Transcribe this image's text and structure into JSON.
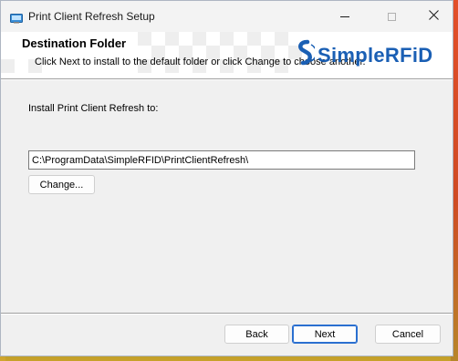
{
  "window": {
    "title": "Print Client Refresh Setup"
  },
  "banner": {
    "title": "Destination Folder",
    "description": "Click Next to install to the default folder or click Change to choose another.",
    "logo_text": "SimpleRFiD"
  },
  "main": {
    "install_label": "Install Print Client Refresh to:",
    "install_path": "C:\\ProgramData\\SimpleRFID\\PrintClientRefresh\\",
    "change_button": "Change..."
  },
  "footer": {
    "back_button": "Back",
    "next_button": "Next",
    "cancel_button": "Cancel"
  },
  "colors": {
    "logo_blue": "#1a5fb4",
    "default_button_border": "#2a6fd0"
  },
  "icons": [
    "installer-icon",
    "minimize-icon",
    "maximize-icon",
    "close-icon",
    "simplerfid-logo-icon"
  ]
}
